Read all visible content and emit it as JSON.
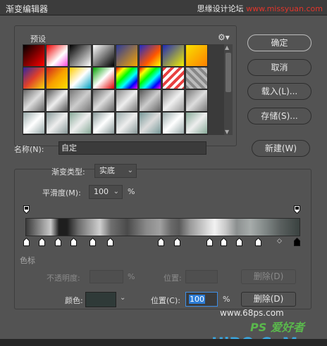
{
  "window": {
    "title": "渐变编辑器",
    "watermark_prefix": "思缘设计论坛",
    "watermark_url": "www.missyuan.com"
  },
  "presets": {
    "label": "预设",
    "gear_icon": "gear-icon",
    "swatches": [
      "linear-gradient(135deg,#000,#f00)",
      "linear-gradient(135deg,#e00,#fff 60%,#f4d)",
      "linear-gradient(135deg,#000,#fff)",
      "linear-gradient(135deg,#fff,#000)",
      "linear-gradient(135deg,#2a3a9a,#f7a500)",
      "linear-gradient(135deg,#1b2cc9,#f50 60%,#ff0)",
      "linear-gradient(135deg,#1e2ab8,#f2f000)",
      "linear-gradient(135deg,#f7e000,#ff8000)",
      "linear-gradient(135deg,#3026a0,#e0402a 50%,#f5d70a)",
      "linear-gradient(135deg,#d02020,#f7a000,#ffe000)",
      "linear-gradient(135deg,#ffcc00,#fff,#00a0c0)",
      "linear-gradient(135deg,#00a000,#fff,#e00000)",
      "linear-gradient(135deg,#f00,#ff0,#0f0,#0ff,#00f,#f0f)",
      "linear-gradient(135deg,#f00,#ff0,#0f0,#0ff,#00f,#f0f)",
      "repeating-linear-gradient(135deg,#e84040 0 4px,#fff 4px 8px)",
      "repeating-linear-gradient(45deg,#888 0 4px,#bbb 4px 8px)",
      "linear-gradient(135deg,#666,#ddd,#666)",
      "linear-gradient(135deg,#555,#eee,#555)",
      "linear-gradient(135deg,#777,#ccc,#777)",
      "linear-gradient(135deg,#666,#ddd,#666)",
      "linear-gradient(135deg,#888,#eee,#777)",
      "linear-gradient(135deg,#555,#ccc,#666)",
      "linear-gradient(135deg,#888,#f0f0f0,#999)",
      "linear-gradient(135deg,#777,#ddd,#777)",
      "linear-gradient(135deg,#9aa,#fff,#9aa)",
      "linear-gradient(135deg,#899,#eee,#899)",
      "linear-gradient(135deg,#8a9,#eee,#8a9)",
      "linear-gradient(135deg,#899,#fff,#899)",
      "linear-gradient(135deg,#9aa,#eee,#899)",
      "linear-gradient(135deg,#799,#ddd,#799)",
      "linear-gradient(135deg,#9aa,#fff,#9aa)",
      "linear-gradient(135deg,#8a9,#eee,#8a9)",
      "linear-gradient(180deg,#fff,#8fb0d8)",
      "linear-gradient(180deg,#fff,#c0d0f0)",
      "linear-gradient(180deg,#fff,#f0a0c0)",
      "linear-gradient(180deg,#fff,#a0c8f0)",
      "linear-gradient(180deg,#fff,#f0a0a0)",
      "linear-gradient(180deg,#fff,#b0e0f0)",
      "linear-gradient(180deg,#fff,#90a8e0)",
      "linear-gradient(180deg,#fff,#f0a0b0)"
    ]
  },
  "buttons": {
    "ok": "确定",
    "cancel": "取消",
    "load": "载入(L)...",
    "save": "存储(S)...",
    "new": "新建(W)"
  },
  "name": {
    "label": "名称(N):",
    "value": "自定"
  },
  "gradient": {
    "type_label": "渐变类型:",
    "type_value": "实底",
    "smooth_label": "平滑度(M):",
    "smooth_value": "100",
    "smooth_unit": "%"
  },
  "stops_section": {
    "title": "色标",
    "opacity_label": "不透明度:",
    "opacity_unit": "%",
    "opacity_pos_label": "位置:",
    "opacity_delete": "删除(D)",
    "color_label": "颜色:",
    "color_value": "#2f3a38",
    "color_pos_label": "位置(C):",
    "color_pos_value": "100",
    "color_pos_unit": "%",
    "color_delete": "删除(D)"
  },
  "watermarks": {
    "site": "www.68ps.com",
    "ps": "PS 爱好者",
    "brand": "UiBQ.CoM"
  }
}
